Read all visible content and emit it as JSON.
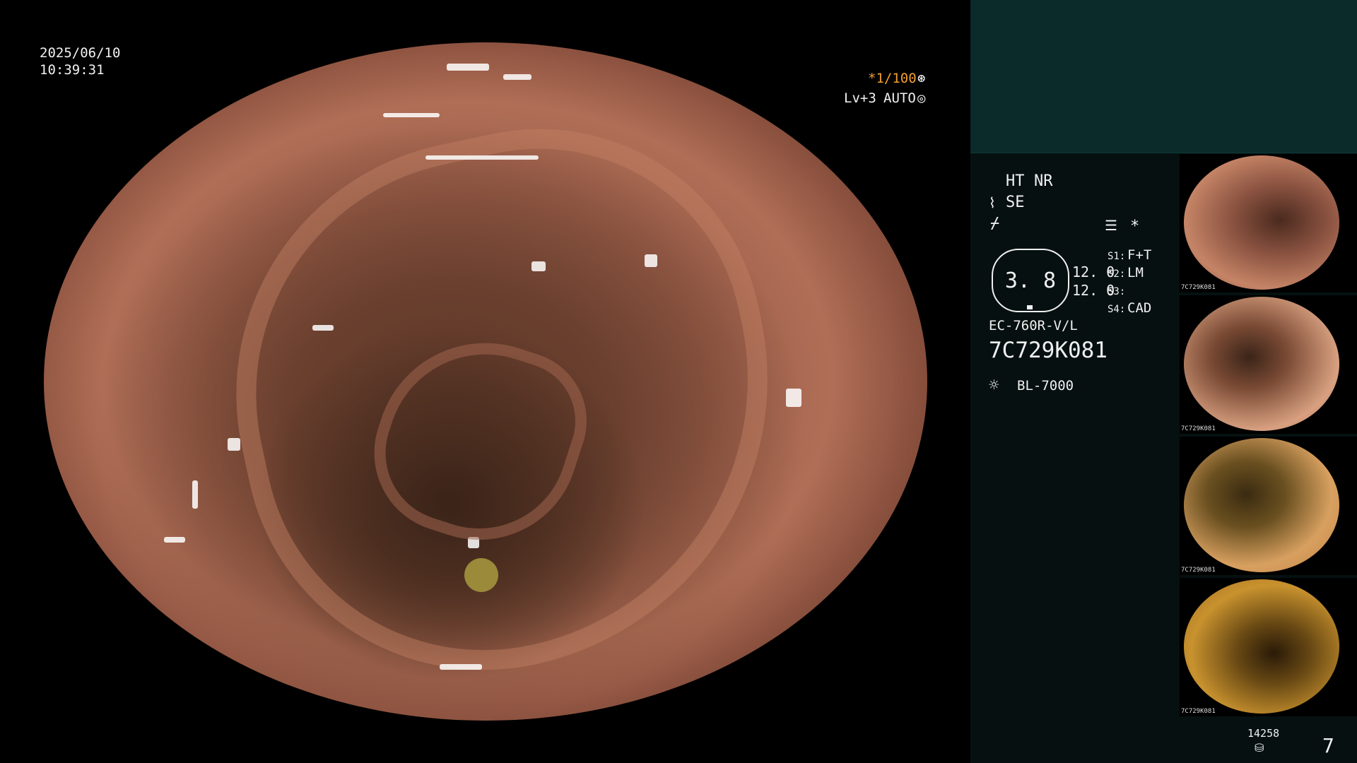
{
  "screen": {
    "date": "2025/06/10",
    "time": "10:39:31",
    "shutter": "*1/100",
    "level": "Lv+3",
    "exposure": "AUTO"
  },
  "settings": {
    "ht": "HT",
    "nr": "NR",
    "se": "SE",
    "star": "*",
    "brightness_value": "3. 8",
    "value_1": "12. 0",
    "value_2": "12. 0",
    "s1_label": "S1:",
    "s1_value": "F+T",
    "s2_label": "S2:",
    "s2_value": "LM",
    "s3_label": "S3:",
    "s3_value": "",
    "s4_label": "S4:",
    "s4_value": "CAD",
    "scope_model": "EC-760R-V/L",
    "scope_serial": "7C729K081",
    "light_source": "BL-7000"
  },
  "thumbnails": [
    {
      "serial": "7C729K081"
    },
    {
      "serial": "7C729K081"
    },
    {
      "serial": "7C729K081"
    },
    {
      "serial": "7C729K081"
    }
  ],
  "storage": {
    "remaining": "14258",
    "count": "7"
  },
  "colors": {
    "accent_amber": "#f0a030",
    "panel_bg": "#061010",
    "preview_bg": "#0b2a2a"
  },
  "icons": [
    "aperture-icon",
    "iris-icon",
    "scope-icon",
    "bolt-icon",
    "menu-icon",
    "lamp-icon",
    "disk-icon"
  ]
}
